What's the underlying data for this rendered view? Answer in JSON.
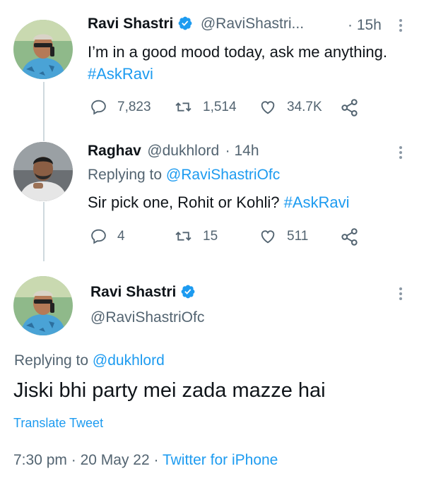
{
  "tweet1": {
    "name": "Ravi Shastri",
    "handle": "@RaviShastri...",
    "time": "· 15h",
    "text_plain": "I’m in a good mood today, ask me anything. ",
    "hashtag": "#AskRavi",
    "replies": "7,823",
    "retweets": "1,514",
    "likes": "34.7K"
  },
  "tweet2": {
    "name": "Raghav",
    "handle": "@dukhlord",
    "time": "· 14h",
    "replying_prefix": "Replying to ",
    "replying_handle": "@RaviShastriOfc",
    "text_plain": "Sir pick one, Rohit or Kohli? ",
    "hashtag": "#AskRavi",
    "replies": "4",
    "retweets": "15",
    "likes": "511"
  },
  "tweet3": {
    "name": "Ravi Shastri",
    "handle": "@RaviShastriOfc",
    "replying_prefix": "Replying to ",
    "replying_handle": "@dukhlord",
    "text": "Jiski bhi party mei zada mazze hai",
    "translate": "Translate Tweet",
    "time": "7:30 pm",
    "date": "20 May 22",
    "source": "Twitter for iPhone"
  },
  "colors": {
    "accent": "#1d9bf0",
    "muted": "#536471",
    "line": "#cfd9de"
  }
}
